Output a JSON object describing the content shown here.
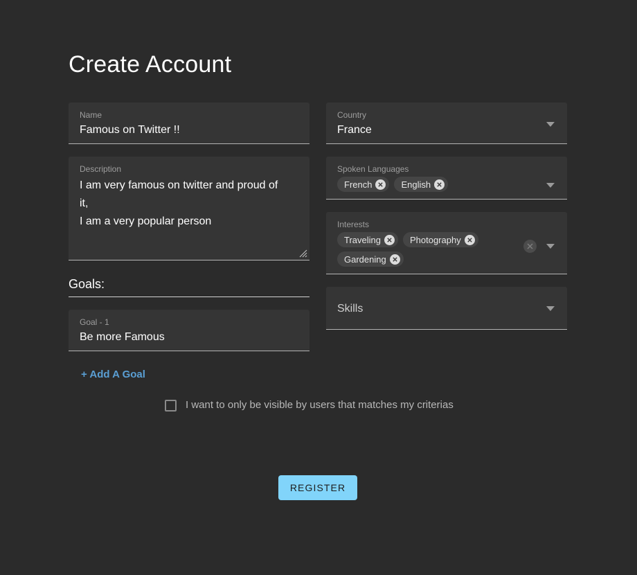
{
  "title": "Create Account",
  "form": {
    "name": {
      "label": "Name",
      "value": "Famous on Twitter !!"
    },
    "description": {
      "label": "Description",
      "value": "I am very famous on twitter and proud of it,\nI am a very popular person"
    },
    "goals_header": "Goals:",
    "goal_1": {
      "label": "Goal - 1",
      "value": "Be more Famous"
    },
    "add_goal_label": "+ Add A Goal",
    "country": {
      "label": "Country",
      "value": "France"
    },
    "spoken_languages": {
      "label": "Spoken Languages",
      "chips": [
        "French",
        "English"
      ]
    },
    "interests": {
      "label": "Interests",
      "chips": [
        "Traveling",
        "Photography",
        "Gardening"
      ]
    },
    "skills": {
      "placeholder": "Skills",
      "value": ""
    },
    "visibility_checkbox": {
      "label": "I want to only be visible by users that matches my criterias",
      "checked": false
    },
    "submit_label": "REGISTER"
  },
  "icons": {
    "dropdown": "chevron-down-icon",
    "chip_remove": "close-circle-icon",
    "clear_all": "clear-all-icon",
    "resize": "resize-grip-icon"
  },
  "colors": {
    "page_background": "#2b2b2b",
    "field_background": "#353535",
    "field_underline": "#b5b5b5",
    "label_text": "#9e9e9e",
    "value_text": "#ffffff",
    "link_blue": "#5a9fd4",
    "button_blue": "#81d4fa",
    "button_text": "#1d1d1d",
    "chip_background": "#454545",
    "chip_text": "#e6e6e6"
  }
}
